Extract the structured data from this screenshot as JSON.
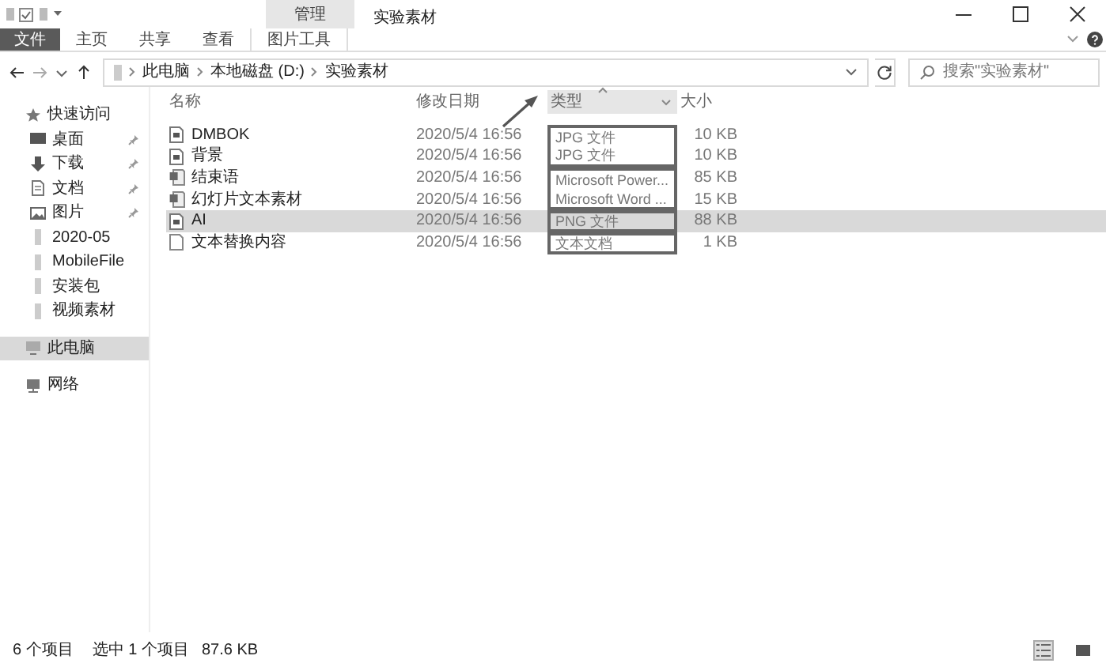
{
  "window": {
    "title": "实验素材",
    "context_label": "管理"
  },
  "ribbon_tabs": [
    {
      "label": "文件",
      "kind": "file"
    },
    {
      "label": "主页",
      "kind": "plain"
    },
    {
      "label": "共享",
      "kind": "plain"
    },
    {
      "label": "查看",
      "kind": "plain"
    },
    {
      "label": "图片工具",
      "kind": "context"
    }
  ],
  "address": {
    "crumbs": [
      "此电脑",
      "本地磁盘 (D:)",
      "实验素材"
    ]
  },
  "search": {
    "placeholder": "搜索\"实验素材\""
  },
  "sidebar": {
    "items": [
      {
        "label": "快速访问",
        "kind": "star",
        "pinned": false,
        "selected": false,
        "children": [
          {
            "label": "桌面",
            "kind": "desktop",
            "pinned": true,
            "selected": false
          },
          {
            "label": "下载",
            "kind": "download",
            "pinned": true,
            "selected": false
          },
          {
            "label": "文档",
            "kind": "document",
            "pinned": true,
            "selected": false
          },
          {
            "label": "图片",
            "kind": "pictures",
            "pinned": true,
            "selected": false
          },
          {
            "label": "2020-05",
            "kind": "folder",
            "pinned": false,
            "selected": false
          },
          {
            "label": "MobileFile",
            "kind": "folder",
            "pinned": false,
            "selected": false
          },
          {
            "label": "安装包",
            "kind": "folder",
            "pinned": false,
            "selected": false
          },
          {
            "label": "视频素材",
            "kind": "folder",
            "pinned": false,
            "selected": false
          }
        ]
      },
      {
        "label": "此电脑",
        "kind": "computer",
        "pinned": false,
        "selected": true
      },
      {
        "label": "网络",
        "kind": "network",
        "pinned": false,
        "selected": false
      }
    ]
  },
  "table": {
    "columns": [
      {
        "label": "名称",
        "sorted": false
      },
      {
        "label": "修改日期",
        "sorted": false
      },
      {
        "label": "类型",
        "sorted": true
      },
      {
        "label": "大小",
        "sorted": false
      }
    ],
    "rows": [
      {
        "name": "DMBOK",
        "date": "2020/5/4 16:56",
        "type": "JPG 文件",
        "size": "10 KB",
        "kind": "image",
        "selected": false,
        "box_top": true,
        "box_bottom": false
      },
      {
        "name": "背景",
        "date": "2020/5/4 16:56",
        "type": "JPG 文件",
        "size": "10 KB",
        "kind": "image",
        "selected": false,
        "box_top": false,
        "box_bottom": true
      },
      {
        "name": "结束语",
        "date": "2020/5/4 16:56",
        "type": "Microsoft Power...",
        "size": "85 KB",
        "kind": "office",
        "selected": false,
        "box_top": true,
        "box_bottom": false
      },
      {
        "name": "幻灯片文本素材",
        "date": "2020/5/4 16:56",
        "type": "Microsoft Word ...",
        "size": "15 KB",
        "kind": "office",
        "selected": false,
        "box_top": false,
        "box_bottom": true
      },
      {
        "name": "AI",
        "date": "2020/5/4 16:56",
        "type": "PNG 文件",
        "size": "88 KB",
        "kind": "image",
        "selected": true,
        "box_top": true,
        "box_bottom": true
      },
      {
        "name": "文本替换内容",
        "date": "2020/5/4 16:56",
        "type": "文本文档",
        "size": "1 KB",
        "kind": "text",
        "selected": false,
        "box_top": true,
        "box_bottom": true
      }
    ]
  },
  "annotation_arrow": true,
  "status_bar": {
    "count": "6 个项目",
    "selection": "选中 1 个项目",
    "selection_size": "87.6 KB"
  }
}
